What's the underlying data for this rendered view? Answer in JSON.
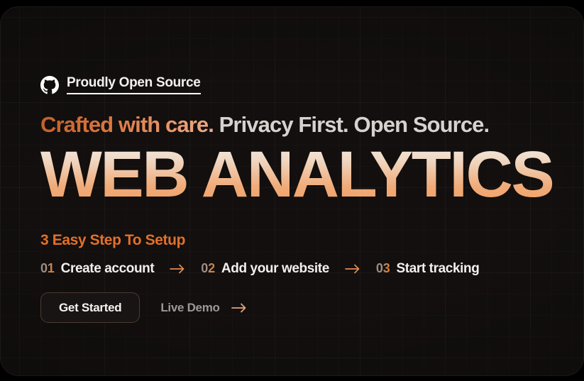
{
  "theme": {
    "page_bg": "#000000",
    "panel_bg": "#120f0e",
    "accent_orange": "#e2702a",
    "accent_orange_light": "#ecab87",
    "text_primary": "#f3f1ef",
    "text_muted": "#9c9895",
    "button_border": "#4a3a30"
  },
  "badge": {
    "icon": "github-icon",
    "label": "Proudly Open Source"
  },
  "tagline": {
    "accent": "Crafted with care.",
    "plain": " Privacy First. Open Source."
  },
  "wordmark": {
    "text": "WEB ANALYTICS"
  },
  "steps_section": {
    "heading": "3 Easy Step To Setup",
    "separator_icon": "arrow-right-icon",
    "steps": [
      {
        "number": "01",
        "label": "Create account"
      },
      {
        "number": "02",
        "label": "Add your website"
      },
      {
        "number": "03",
        "label": "Start tracking"
      }
    ]
  },
  "cta": {
    "primary_label": "Get Started",
    "secondary_label": "Live Demo",
    "secondary_icon": "arrow-right-icon"
  }
}
